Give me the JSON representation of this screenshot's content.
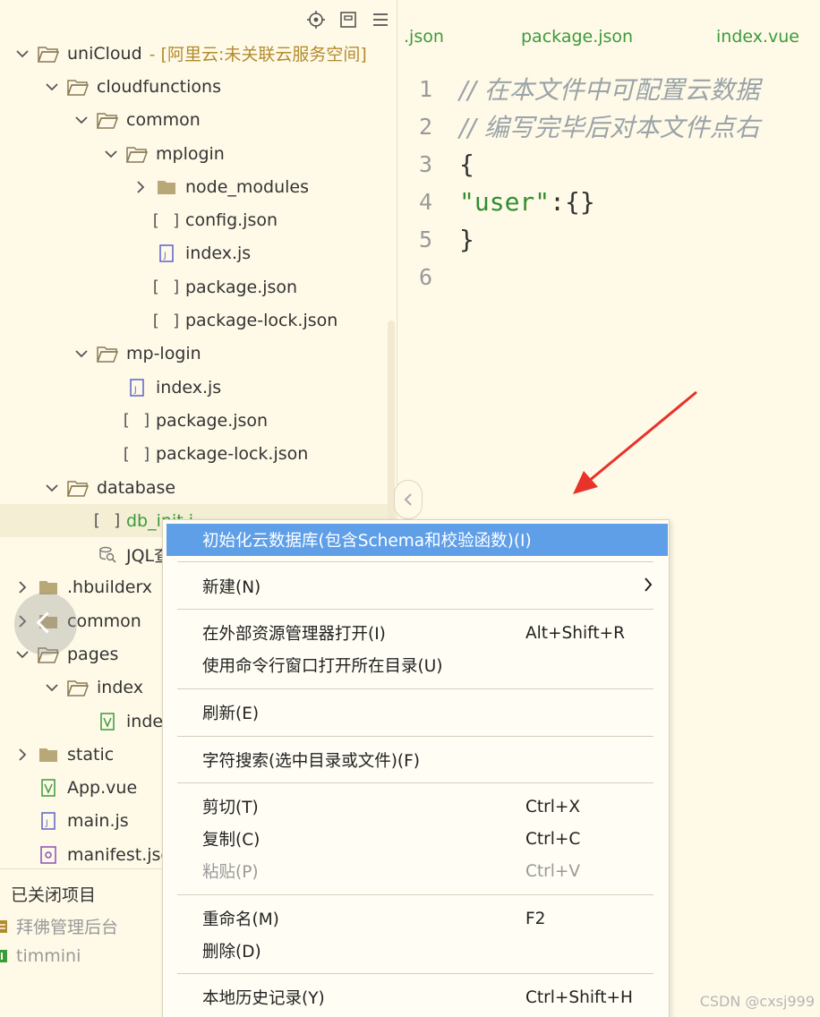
{
  "explorer": {
    "tree": [
      {
        "label": "uniCloud",
        "suffix": "- [阿里云:未关联云服务空间]",
        "depth": 0,
        "chev": "down",
        "icon": "folder-open"
      },
      {
        "label": "cloudfunctions",
        "depth": 1,
        "chev": "down",
        "icon": "folder-open"
      },
      {
        "label": "common",
        "depth": 2,
        "chev": "down",
        "icon": "folder-open"
      },
      {
        "label": "mplogin",
        "depth": 3,
        "chev": "down",
        "icon": "folder-open"
      },
      {
        "label": "node_modules",
        "depth": 4,
        "chev": "right",
        "icon": "folder"
      },
      {
        "label": "config.json",
        "depth": 4,
        "icon": "json"
      },
      {
        "label": "index.js",
        "depth": 4,
        "icon": "js"
      },
      {
        "label": "package.json",
        "depth": 4,
        "icon": "json"
      },
      {
        "label": "package-lock.json",
        "depth": 4,
        "icon": "json"
      },
      {
        "label": "mp-login",
        "depth": 2,
        "chev": "down",
        "icon": "folder-open"
      },
      {
        "label": "index.js",
        "depth": 3,
        "icon": "js"
      },
      {
        "label": "package.json",
        "depth": 3,
        "icon": "json"
      },
      {
        "label": "package-lock.json",
        "depth": 3,
        "icon": "json"
      },
      {
        "label": "database",
        "depth": 1,
        "chev": "down",
        "icon": "folder-open"
      },
      {
        "label": "db_init.j",
        "depth": 2,
        "icon": "json",
        "selected": true,
        "green": true
      },
      {
        "label": "JQL查",
        "depth": 2,
        "icon": "db-search"
      },
      {
        "label": ".hbuilderx",
        "depth": 0,
        "chev": "right",
        "icon": "folder"
      },
      {
        "label": "common",
        "depth": 0,
        "chev": "right",
        "icon": "folder"
      },
      {
        "label": "pages",
        "depth": 0,
        "chev": "down",
        "icon": "folder-open"
      },
      {
        "label": "index",
        "depth": 1,
        "chev": "down",
        "icon": "folder-open"
      },
      {
        "label": "inde",
        "depth": 2,
        "icon": "vue"
      },
      {
        "label": "static",
        "depth": 0,
        "chev": "right",
        "icon": "folder"
      },
      {
        "label": "App.vue",
        "depth": 0,
        "icon": "vue"
      },
      {
        "label": "main.js",
        "depth": 0,
        "icon": "js"
      },
      {
        "label": "manifest.jso",
        "depth": 0,
        "icon": "manifest"
      }
    ],
    "closed": {
      "title": "已关闭项目",
      "items": [
        "拜佛管理后台",
        "timmini"
      ]
    }
  },
  "editor": {
    "tabs": [
      ".json",
      "package.json",
      "index.vue"
    ],
    "lines": [
      {
        "n": "1",
        "text": "// 在本文件中可配置云数据"
      },
      {
        "n": "2",
        "text": "// 编写完毕后对本文件点右"
      },
      {
        "n": "3",
        "text": "{"
      },
      {
        "n": "4",
        "key": "\"user\"",
        "rest": ":{}"
      },
      {
        "n": "5",
        "text": "}"
      },
      {
        "n": "6",
        "text": ""
      }
    ]
  },
  "menu": {
    "init_db": "初始化云数据库(包含Schema和校验函数)(I)",
    "new": "新建(N)",
    "open_explorer": "在外部资源管理器打开(I)",
    "open_explorer_key": "Alt+Shift+R",
    "open_cmd": "使用命令行窗口打开所在目录(U)",
    "refresh": "刷新(E)",
    "char_search": "字符搜索(选中目录或文件)(F)",
    "cut": "剪切(T)",
    "cut_key": "Ctrl+X",
    "copy": "复制(C)",
    "copy_key": "Ctrl+C",
    "paste": "粘贴(P)",
    "paste_key": "Ctrl+V",
    "rename": "重命名(M)",
    "rename_key": "F2",
    "delete": "删除(D)",
    "history": "本地历史记录(Y)",
    "history_key": "Ctrl+Shift+H"
  },
  "watermark": "CSDN @cxsj999",
  "colors": {
    "accent": "#5f9fe8",
    "green": "#3a9b3a",
    "background": "#fffae8",
    "arrow": "#e8322a"
  }
}
